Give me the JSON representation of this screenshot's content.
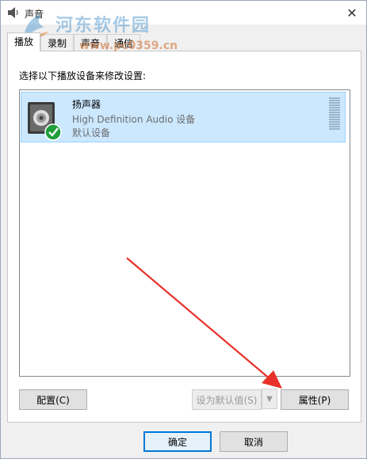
{
  "window": {
    "title": "声音",
    "close_symbol": "✕"
  },
  "watermark": {
    "title": "河东软件园",
    "url": "www.pc0359.cn"
  },
  "tabs": [
    {
      "label": "播放",
      "active": true
    },
    {
      "label": "录制",
      "active": false
    },
    {
      "label": "声音",
      "active": false
    },
    {
      "label": "通信",
      "active": false
    }
  ],
  "panel": {
    "instruction": "选择以下播放设备来修改设置:",
    "device": {
      "name": "扬声器",
      "description": "High Definition Audio 设备",
      "status": "默认设备",
      "selected": true,
      "level": 0
    }
  },
  "buttons": {
    "configure": "配置(C)",
    "set_default": "设为默认值(S)",
    "properties": "属性(P)",
    "ok": "确定",
    "cancel": "取消"
  },
  "colors": {
    "selection_bg": "#cce8ff",
    "selection_border": "#99d1ff",
    "primary_border": "#0078d7",
    "annotation_arrow": "#e8312a",
    "default_check": "#1e9e3a"
  }
}
